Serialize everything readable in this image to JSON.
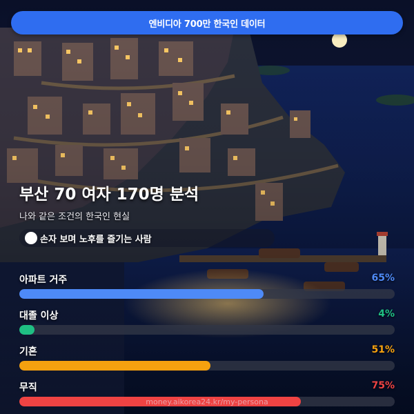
{
  "banner": {
    "text": "엔비디아 700만 한국인 데이터"
  },
  "headline": {
    "text": "부산 70 여자 170명 분석"
  },
  "subtitle": {
    "text": "나와 같은 조건의 한국인 현실"
  },
  "trait": {
    "emoji_icon": "white-circle-emoji",
    "label": "손자 보며 노후를 즐기는 사람"
  },
  "stats": [
    {
      "label": "아파트 거주",
      "percent_text": "65%",
      "value": 0.65,
      "color": "#4e8af7"
    },
    {
      "label": "대졸 이상",
      "percent_text": "4%",
      "value": 0.04,
      "color": "#1fbf83"
    },
    {
      "label": "기혼",
      "percent_text": "51%",
      "value": 0.51,
      "color": "#f5a10f"
    },
    {
      "label": "무직",
      "percent_text": "75%",
      "value": 0.75,
      "color": "#ef4343"
    }
  ],
  "footer": {
    "url": "money.aikorea24.kr/my-persona"
  },
  "colors": {
    "banner_bg": "#2f6df0",
    "track_bg": "#363b4a"
  }
}
